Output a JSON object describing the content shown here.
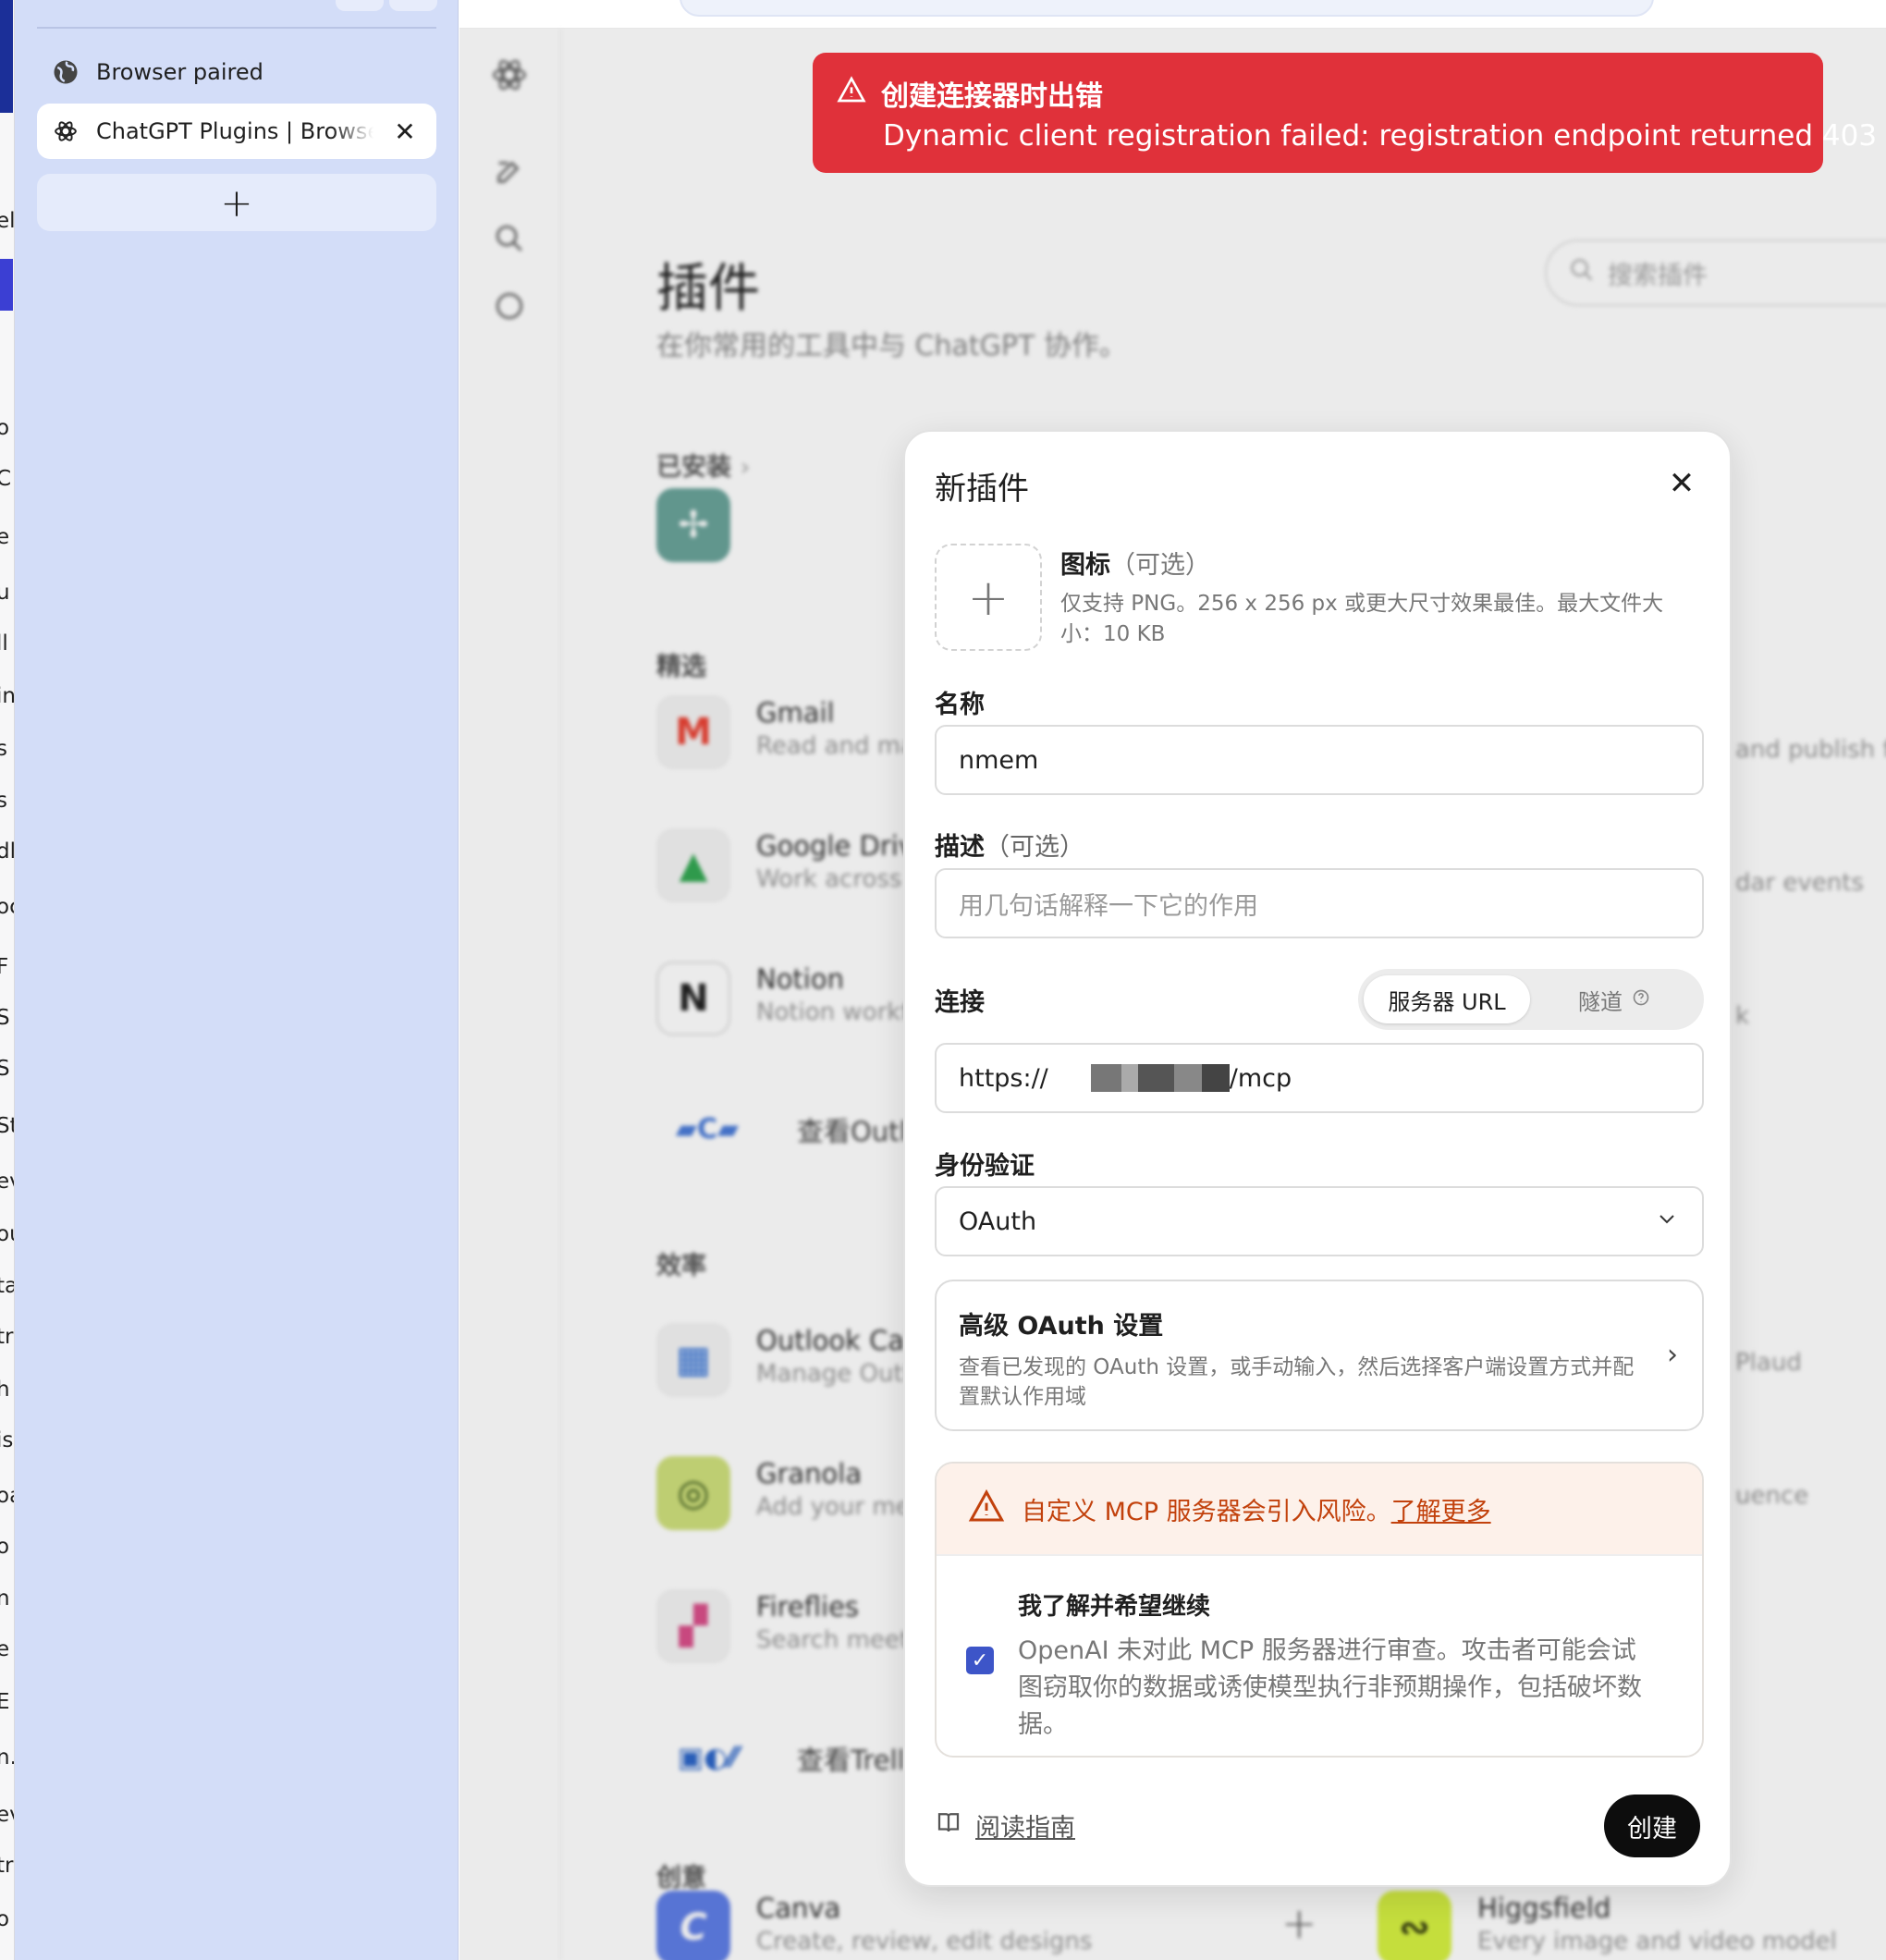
{
  "side_panel": {
    "paired_label": "Browser paired",
    "tab_label": "ChatGPT Plugins | Browse",
    "new_tab_label": "+"
  },
  "left_strip_fragments": [
    "el",
    "o",
    "C",
    "e",
    "u",
    "ll",
    "in",
    "s",
    "s",
    "dle",
    "oc",
    "F",
    "S",
    "S",
    "St",
    "ev",
    "ou",
    "ta",
    "tr",
    "h",
    "is",
    "oa",
    "o",
    "n",
    "e",
    "E",
    "n.",
    "ev",
    "tr",
    "o"
  ],
  "main": {
    "title": "插件",
    "subtitle": "在你常用的工具中与 ChatGPT 协作。",
    "search_placeholder": "搜索插件",
    "sections": {
      "installed": "已安装",
      "featured": "精选",
      "productivity": "效率",
      "creative": "创意"
    },
    "featured_apps": [
      {
        "name": "Gmail",
        "desc": "Read and ma"
      },
      {
        "name": "Google Drive",
        "desc": "Work across l"
      },
      {
        "name": "Notion",
        "desc": "Notion workfl"
      }
    ],
    "featured_more": "查看Outl",
    "productivity_apps": [
      {
        "name": "Outlook Cale",
        "desc": "Manage Outl"
      },
      {
        "name": "Granola",
        "desc": "Add your mee"
      },
      {
        "name": "Fireflies",
        "desc": "Search meeti"
      }
    ],
    "productivity_more": "查看Trell",
    "creative_apps": [
      {
        "name": "Canva",
        "desc": "Create, review, edit designs"
      },
      {
        "name": "Higgsfield",
        "desc": "Every image and video model"
      }
    ],
    "right_fragments": [
      "and publish fil",
      "dar events",
      "k",
      "Plaud",
      "uence"
    ]
  },
  "toast": {
    "title": "创建连接器时出错",
    "message": "Dynamic client registration failed: registration endpoint returned 403",
    "color": "#e0313a"
  },
  "dialog": {
    "title": "新插件",
    "icon_label": "图标",
    "icon_optional": "（可选）",
    "icon_help": "仅支持 PNG。256 x 256 px 或更大尺寸效果最佳。最大文件大小：10 KB",
    "name_label": "名称",
    "name_value": "nmem",
    "desc_label": "描述",
    "desc_optional": "（可选）",
    "desc_placeholder": "用几句话解释一下它的作用",
    "conn_label": "连接",
    "conn_options": [
      "服务器 URL",
      "隧道"
    ],
    "conn_selected": "服务器 URL",
    "url_prefix": "https://",
    "url_suffix": "/mcp",
    "auth_label": "身份验证",
    "auth_value": "OAuth",
    "adv_title": "高级 OAuth 设置",
    "adv_desc": "查看已发现的 OAuth 设置，或手动输入，然后选择客户端设置方式并配置默认作用域",
    "risk_text": "自定义 MCP 服务器会引入风险。",
    "risk_link": "了解更多",
    "ack_title": "我了解并希望继续",
    "ack_desc": "OpenAI 未对此 MCP 服务器进行审查。攻击者可能会试图窃取你的数据或诱使模型执行非预期操作，包括破坏数据。",
    "ack_checked": true,
    "guide_link": "阅读指南",
    "create_label": "创建"
  }
}
